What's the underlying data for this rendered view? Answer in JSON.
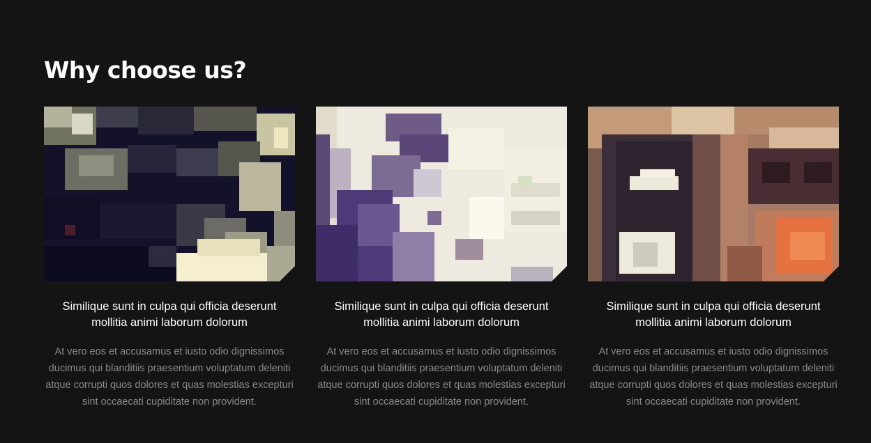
{
  "section": {
    "heading": "Why choose us?"
  },
  "cards": [
    {
      "title": "Similique sunt in culpa qui officia deserunt mollitia animi laborum dolorum",
      "text": "At vero eos et accusamus et iusto odio dignissimos ducimus qui blanditiis praesentium voluptatum deleniti atque corrupti quos dolores et quas molestias excepturi sint occaecati cupiditate non provident.",
      "image": "pixelated-dark-photo"
    },
    {
      "title": "Similique sunt in culpa qui officia deserunt mollitia animi laborum dolorum",
      "text": "At vero eos et accusamus et iusto odio dignissimos ducimus qui blanditiis praesentium voluptatum deleniti atque corrupti quos dolores et quas molestias excepturi sint occaecati cupiditate non provident.",
      "image": "pixelated-bright-photo"
    },
    {
      "title": "Similique sunt in culpa qui officia deserunt mollitia animi laborum dolorum",
      "text": "At vero eos et accusamus et iusto odio dignissimos ducimus qui blanditiis praesentium voluptatum deleniti atque corrupti quos dolores et quas molestias excepturi sint occaecati cupiditate non provident.",
      "image": "pixelated-vinyl-photo"
    }
  ],
  "colors": {
    "background": "#141414",
    "heading": "#ffffff",
    "card_title": "#ffffff",
    "card_text": "#8a8a8a"
  }
}
